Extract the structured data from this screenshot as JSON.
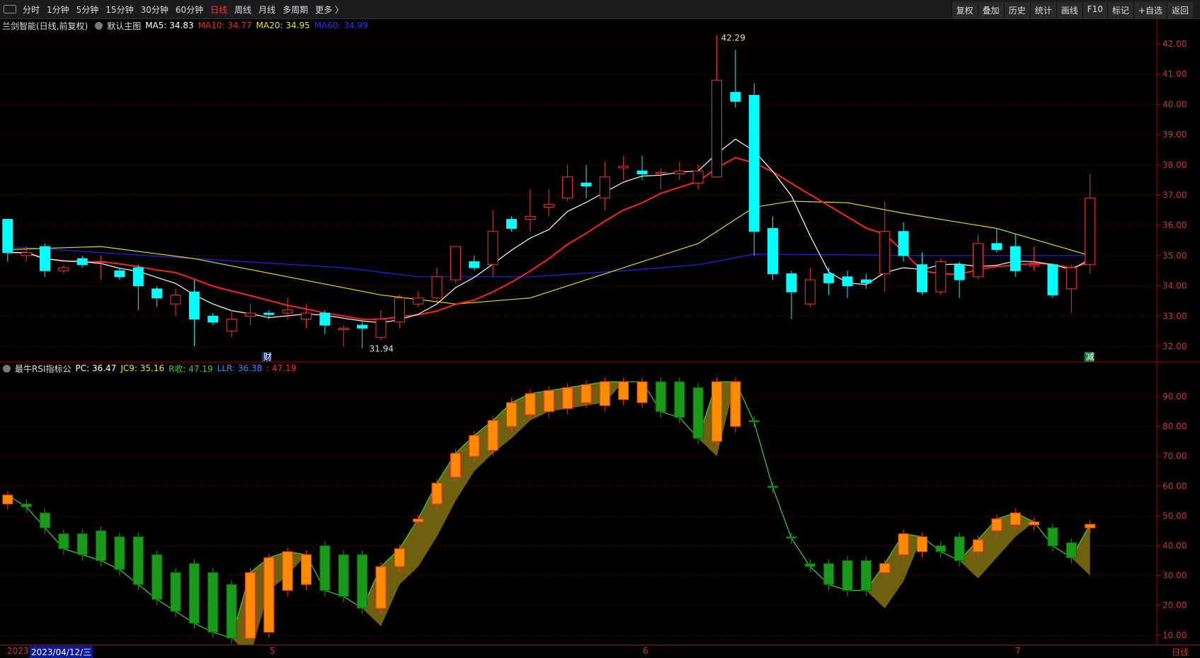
{
  "toolbar": {
    "periods": [
      "分时",
      "1分钟",
      "5分钟",
      "15分钟",
      "30分钟",
      "60分钟",
      "日线",
      "周线",
      "月线",
      "多周期",
      "更多 〉"
    ],
    "active": "日线",
    "buttons": [
      "复权",
      "叠加",
      "历史",
      "统计",
      "画线",
      "F10",
      "标记",
      "+自选",
      "返回"
    ]
  },
  "main_legend": {
    "title": "兰剑智能(日线,前复权)",
    "template": "默认主图",
    "ma5": "MA5: 34.83",
    "ma10": "MA10: 34.77",
    "ma20": "MA20: 34.95",
    "ma60": "MA60: 34.99"
  },
  "rsi_legend": {
    "title": "最牛RSI指标公",
    "pc": "PC: 36.47",
    "jc9": "JC9: 35.16",
    "r": "R收: 47.19",
    "llr": "LLR: 36.38",
    "last": ": 47.19"
  },
  "colors": {
    "up": "#ff3030",
    "down": "#00ffff",
    "ma5": "#ffffff",
    "ma10": "#ff2020",
    "ma20": "#e0e000",
    "ma60": "#2020ff",
    "rsi_up": "#ff8c00",
    "rsi_down": "#1a9a1a",
    "band": "#7a6a10",
    "grid": "#5a0000"
  },
  "annotations": {
    "high": "42.29",
    "low": "31.94",
    "marker1": "财",
    "marker2": "减"
  },
  "dateaxis": {
    "year": "2023",
    "selected": "2023/04/12/三",
    "months": [
      "5",
      "6",
      "7"
    ],
    "period": "日线"
  },
  "chart_data": [
    {
      "type": "candlestick",
      "name": "price",
      "ylim": [
        31.7,
        42.6
      ],
      "yticks": [
        "42.00",
        "41.00",
        "40.00",
        "39.00",
        "38.00",
        "37.00",
        "36.00",
        "35.00",
        "34.00",
        "33.00",
        "32.00"
      ],
      "ohlc": [
        [
          36.2,
          36.2,
          34.8,
          35.1
        ],
        [
          35.0,
          35.3,
          34.8,
          35.1
        ],
        [
          35.3,
          35.4,
          34.3,
          34.5
        ],
        [
          34.5,
          34.7,
          34.4,
          34.6
        ],
        [
          34.9,
          35.0,
          34.6,
          34.7
        ],
        [
          34.8,
          35.0,
          34.2,
          34.8
        ],
        [
          34.5,
          34.6,
          34.2,
          34.3
        ],
        [
          34.6,
          34.7,
          33.2,
          34.0
        ],
        [
          33.9,
          34.0,
          33.3,
          33.6
        ],
        [
          33.4,
          33.9,
          33.0,
          33.7
        ],
        [
          33.8,
          34.2,
          32.0,
          32.9
        ],
        [
          33.0,
          33.1,
          32.7,
          32.8
        ],
        [
          32.5,
          33.2,
          32.3,
          32.9
        ],
        [
          33.0,
          33.4,
          32.7,
          33.1
        ],
        [
          33.1,
          33.2,
          32.9,
          33.05
        ],
        [
          33.1,
          33.6,
          32.9,
          33.2
        ],
        [
          32.9,
          33.4,
          32.6,
          33.1
        ],
        [
          33.1,
          33.2,
          32.4,
          32.7
        ],
        [
          32.55,
          32.7,
          32.0,
          32.6
        ],
        [
          32.7,
          32.8,
          31.94,
          32.6
        ],
        [
          32.3,
          33.2,
          32.2,
          32.9
        ],
        [
          32.8,
          33.7,
          32.6,
          33.6
        ],
        [
          33.4,
          33.8,
          33.3,
          33.6
        ],
        [
          33.6,
          34.6,
          33.5,
          34.3
        ],
        [
          34.2,
          35.3,
          34.1,
          35.3
        ],
        [
          34.8,
          35.0,
          34.5,
          34.6
        ],
        [
          34.7,
          36.5,
          34.3,
          35.8
        ],
        [
          36.2,
          36.3,
          35.8,
          35.9
        ],
        [
          36.2,
          37.2,
          35.8,
          36.3
        ],
        [
          36.6,
          37.2,
          36.3,
          36.7
        ],
        [
          36.9,
          38.0,
          36.8,
          37.6
        ],
        [
          37.4,
          38.0,
          36.9,
          37.3
        ],
        [
          36.9,
          38.1,
          36.5,
          37.6
        ],
        [
          37.9,
          38.3,
          37.5,
          37.95
        ],
        [
          37.8,
          38.3,
          37.5,
          37.7
        ],
        [
          37.7,
          37.9,
          37.2,
          37.75
        ],
        [
          37.7,
          38.1,
          37.5,
          37.8
        ],
        [
          37.4,
          38.0,
          37.2,
          37.8
        ],
        [
          37.6,
          42.29,
          37.6,
          40.8
        ],
        [
          40.4,
          41.8,
          39.9,
          40.1
        ],
        [
          40.3,
          40.7,
          35.0,
          35.8
        ],
        [
          35.9,
          36.3,
          34.2,
          34.4
        ],
        [
          34.4,
          34.5,
          32.9,
          33.8
        ],
        [
          33.4,
          34.6,
          33.3,
          34.2
        ],
        [
          34.4,
          34.6,
          33.7,
          34.1
        ],
        [
          34.3,
          34.5,
          33.6,
          34.0
        ],
        [
          34.2,
          34.4,
          33.9,
          34.1
        ],
        [
          34.4,
          36.8,
          33.8,
          35.8
        ],
        [
          35.8,
          36.1,
          34.8,
          35.0
        ],
        [
          34.7,
          35.1,
          33.7,
          33.8
        ],
        [
          33.8,
          34.9,
          33.7,
          34.8
        ],
        [
          34.7,
          34.8,
          33.6,
          34.2
        ],
        [
          34.3,
          35.7,
          34.2,
          35.4
        ],
        [
          35.4,
          35.9,
          35.1,
          35.2
        ],
        [
          35.3,
          35.7,
          34.3,
          34.5
        ],
        [
          34.65,
          35.3,
          34.5,
          34.7
        ],
        [
          34.7,
          34.75,
          33.6,
          33.7
        ],
        [
          33.9,
          34.7,
          33.1,
          34.6
        ],
        [
          34.7,
          37.7,
          34.4,
          36.9
        ]
      ],
      "ma20_keys": [
        [
          0,
          35.2
        ],
        [
          5,
          35.3
        ],
        [
          10,
          34.9
        ],
        [
          15,
          34.3
        ],
        [
          20,
          33.7
        ],
        [
          24,
          33.4
        ],
        [
          28,
          33.6
        ],
        [
          33,
          34.6
        ],
        [
          37,
          35.4
        ],
        [
          40,
          36.6
        ],
        [
          42,
          36.8
        ],
        [
          45,
          36.75
        ],
        [
          48,
          36.4
        ],
        [
          53,
          35.9
        ],
        [
          58,
          35.0
        ]
      ],
      "ma60_keys": [
        [
          0,
          35.3
        ],
        [
          10,
          34.9
        ],
        [
          18,
          34.6
        ],
        [
          22,
          34.3
        ],
        [
          28,
          34.3
        ],
        [
          33,
          34.5
        ],
        [
          37,
          34.7
        ],
        [
          40,
          35.05
        ],
        [
          50,
          35.0
        ],
        [
          58,
          35.0
        ]
      ]
    },
    {
      "type": "bar",
      "name": "rsi",
      "ylim": [
        8,
        96
      ],
      "yticks": [
        "90.00",
        "80.00",
        "70.00",
        "60.00",
        "50.00",
        "40.00",
        "30.00",
        "20.00",
        "10.00"
      ],
      "bars": [
        [
          54,
          57
        ],
        [
          54,
          53
        ],
        [
          51,
          46
        ],
        [
          44,
          39
        ],
        [
          44,
          37
        ],
        [
          45,
          35
        ],
        [
          43,
          32
        ],
        [
          43,
          27
        ],
        [
          37,
          22
        ],
        [
          31,
          18
        ],
        [
          34,
          14
        ],
        [
          31,
          11
        ],
        [
          27,
          9
        ],
        [
          9,
          31
        ],
        [
          11,
          36
        ],
        [
          25,
          38
        ],
        [
          27,
          37
        ],
        [
          40,
          25
        ],
        [
          37,
          23
        ],
        [
          37,
          19
        ],
        [
          19,
          33
        ],
        [
          33,
          39
        ],
        [
          48,
          49
        ],
        [
          54,
          61
        ],
        [
          63,
          71
        ],
        [
          70,
          77
        ],
        [
          72,
          82
        ],
        [
          80,
          88
        ],
        [
          84,
          91
        ],
        [
          85,
          92
        ],
        [
          86,
          93
        ],
        [
          88,
          94
        ],
        [
          87,
          95
        ],
        [
          89,
          95
        ],
        [
          88,
          95
        ],
        [
          95,
          85
        ],
        [
          95,
          83
        ],
        [
          93,
          76
        ],
        [
          75,
          95
        ],
        [
          80,
          95
        ],
        [
          82,
          81.5
        ],
        [
          60,
          59.5
        ],
        [
          43,
          42.5
        ],
        [
          34,
          33
        ],
        [
          34,
          27
        ],
        [
          35,
          25
        ],
        [
          35,
          25
        ],
        [
          31,
          34
        ],
        [
          37,
          44
        ],
        [
          38,
          43
        ],
        [
          40,
          38
        ],
        [
          43,
          35
        ],
        [
          38,
          42
        ],
        [
          45,
          49
        ],
        [
          47,
          51
        ],
        [
          47,
          48
        ],
        [
          46,
          40
        ],
        [
          41,
          36
        ],
        [
          46,
          47.2
        ]
      ]
    }
  ]
}
